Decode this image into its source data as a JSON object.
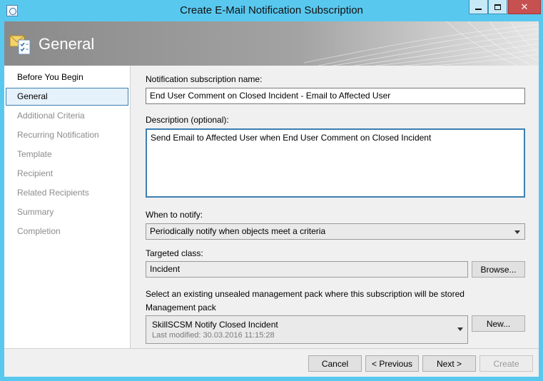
{
  "window": {
    "title": "Create E-Mail Notification Subscription",
    "close_glyph": "✕"
  },
  "banner": {
    "title": "General"
  },
  "nav": {
    "items": [
      {
        "label": "Before You Begin",
        "state": "done"
      },
      {
        "label": "General",
        "state": "active"
      },
      {
        "label": "Additional Criteria",
        "state": "pending"
      },
      {
        "label": "Recurring Notification",
        "state": "pending"
      },
      {
        "label": "Template",
        "state": "pending"
      },
      {
        "label": "Recipient",
        "state": "pending"
      },
      {
        "label": "Related Recipients",
        "state": "pending"
      },
      {
        "label": "Summary",
        "state": "pending"
      },
      {
        "label": "Completion",
        "state": "pending"
      }
    ]
  },
  "form": {
    "name_label": "Notification subscription name:",
    "name_value": "End User Comment on Closed Incident - Email to Affected User",
    "description_label": "Description (optional):",
    "description_value": "Send Email to Affected User when End User Comment on Closed Incident",
    "when_label": "When to notify:",
    "when_value": "Periodically notify when objects meet a criteria",
    "class_label": "Targeted class:",
    "class_value": "Incident",
    "browse_label": "Browse...",
    "mp_instruction": "Select an existing unsealed management pack where this subscription will be stored",
    "mp_label": "Management pack",
    "mp_name": "SkillSCSM Notify Closed Incident",
    "mp_modified": "Last modified:  30.03.2016 11:15:28",
    "new_label": "New..."
  },
  "footer": {
    "cancel_label": "Cancel",
    "previous_label": "< Previous",
    "next_label": "Next >",
    "create_label": "Create"
  },
  "colors": {
    "titlebar": "#59c8ef",
    "active_nav_border": "#3c7fb1",
    "close_button": "#c75050"
  }
}
